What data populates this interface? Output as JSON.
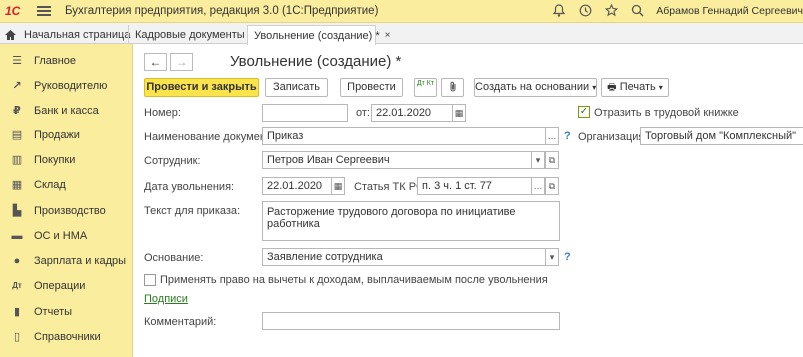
{
  "app": {
    "logo": "1C",
    "title": "Бухгалтерия предприятия, редакция 3.0  (1С:Предприятие)",
    "user": "Абрамов Геннадий Сергеевич"
  },
  "titlebar_icons": [
    "bell-icon",
    "history-icon",
    "star-icon",
    "search-icon"
  ],
  "tabs": {
    "home": "Начальная страница",
    "items": [
      {
        "label": "Кадровые документы",
        "close": "×"
      },
      {
        "label": "Увольнение (создание) *",
        "close": "×"
      }
    ]
  },
  "sidebar": {
    "items": [
      {
        "label": "Главное",
        "icon": "menu-icon"
      },
      {
        "label": "Руководителю",
        "icon": "trend-icon"
      },
      {
        "label": "Банк и касса",
        "icon": "bank-icon"
      },
      {
        "label": "Продажи",
        "icon": "sales-icon"
      },
      {
        "label": "Покупки",
        "icon": "cart-icon"
      },
      {
        "label": "Склад",
        "icon": "warehouse-icon"
      },
      {
        "label": "Производство",
        "icon": "factory-icon"
      },
      {
        "label": "ОС и НМА",
        "icon": "truck-icon"
      },
      {
        "label": "Зарплата и кадры",
        "icon": "person-icon"
      },
      {
        "label": "Операции",
        "icon": "operations-icon"
      },
      {
        "label": "Отчеты",
        "icon": "reports-icon"
      },
      {
        "label": "Справочники",
        "icon": "book-icon"
      }
    ]
  },
  "document": {
    "title": "Увольнение (создание) *",
    "nav": {
      "back": "←",
      "forward": "→"
    }
  },
  "toolbar": {
    "post_close": "Провести и закрыть",
    "save": "Записать",
    "post": "Провести",
    "dt_kt": "Дт Кт",
    "create_based": "Создать на основании",
    "print": "Печать"
  },
  "form": {
    "number_label": "Номер:",
    "number_value": "",
    "from_label": "от:",
    "date_value": "22.01.2020",
    "record_book_label": "Отразить в трудовой книжке",
    "record_book_checked": true,
    "docname_label": "Наименование документа:",
    "docname_value": "Приказ",
    "organization_label": "Организация:",
    "organization_value": "Торговый дом \"Комплексный\"",
    "employee_label": "Сотрудник:",
    "employee_value": "Петров Иван Сергеевич",
    "dismissal_date_label": "Дата увольнения:",
    "dismissal_date_value": "22.01.2020",
    "article_label": "Статья ТК РФ:",
    "article_value": "п. 3 ч. 1 ст. 77",
    "order_text_label": "Текст для приказа:",
    "order_text_value": "Расторжение трудового договора по инициативе работника",
    "basis_label": "Основание:",
    "basis_value": "Заявление сотрудника",
    "deductions_label": "Применять право на вычеты к доходам, выплачиваемым после увольнения",
    "signatures_link": "Подписи",
    "comment_label": "Комментарий:",
    "comment_value": ""
  },
  "colors": {
    "panel": "#fbed9e",
    "primary_button": "#fbe34b",
    "help": "#3a7fc6",
    "link": "#2a7e1e"
  }
}
